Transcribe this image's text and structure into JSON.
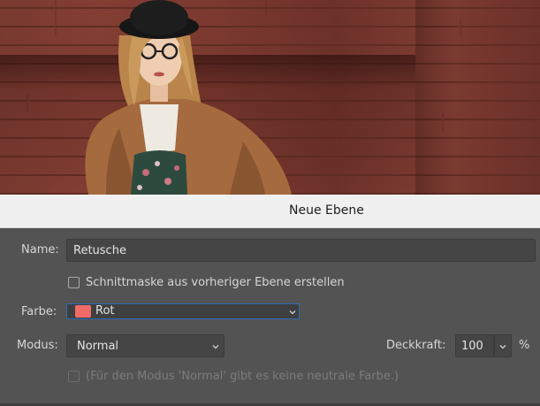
{
  "dialog": {
    "title": "Neue Ebene",
    "name": {
      "label": "Name:",
      "value": "Retusche"
    },
    "clipping_mask": {
      "label": "Schnittmaske aus vorheriger Ebene erstellen",
      "checked": false
    },
    "color": {
      "label": "Farbe:",
      "value": "Rot",
      "swatch": "#f06b66"
    },
    "mode": {
      "label": "Modus:",
      "value": "Normal"
    },
    "opacity": {
      "label": "Deckkraft:",
      "value": "100",
      "unit": "%"
    },
    "neutral_fill": {
      "label": "(Für den Modus 'Normal' gibt es keine neutrale Farbe.)",
      "checked": false,
      "enabled": false
    }
  },
  "colors": {
    "dialog_bg": "#535353",
    "titlebar_bg": "#f0f0f0",
    "focus_border": "#2f6ab5",
    "text": "#d6d6d6",
    "disabled_text": "#7c7c7c"
  },
  "icons": {
    "dropdown": "chevron-down-icon",
    "checkbox": "checkbox-icon"
  }
}
